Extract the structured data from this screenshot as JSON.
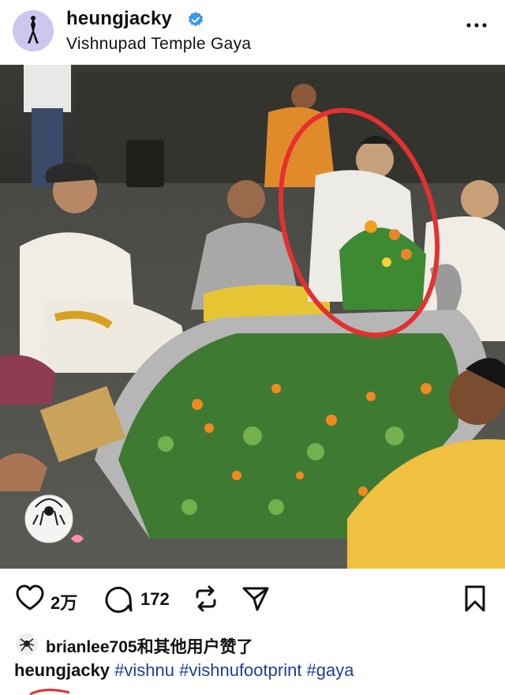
{
  "post": {
    "username": "heungjacky",
    "location": "Vishnupad Temple  Gaya",
    "verified_icon": "verified-badge-icon",
    "more_icon": "more-options-icon"
  },
  "actions": {
    "like_count": "2万",
    "comment_count": "172"
  },
  "likes": {
    "text": "brianlee705和其他用户赞了"
  },
  "caption": {
    "username": "heungjacky",
    "hashtags": [
      " #vishnu",
      " #vishnufootprint",
      " #gaya"
    ]
  },
  "colors": {
    "accent_blue": "#1d3f9a",
    "verified_blue": "#3897f0",
    "highlight_red": "#e53030"
  }
}
